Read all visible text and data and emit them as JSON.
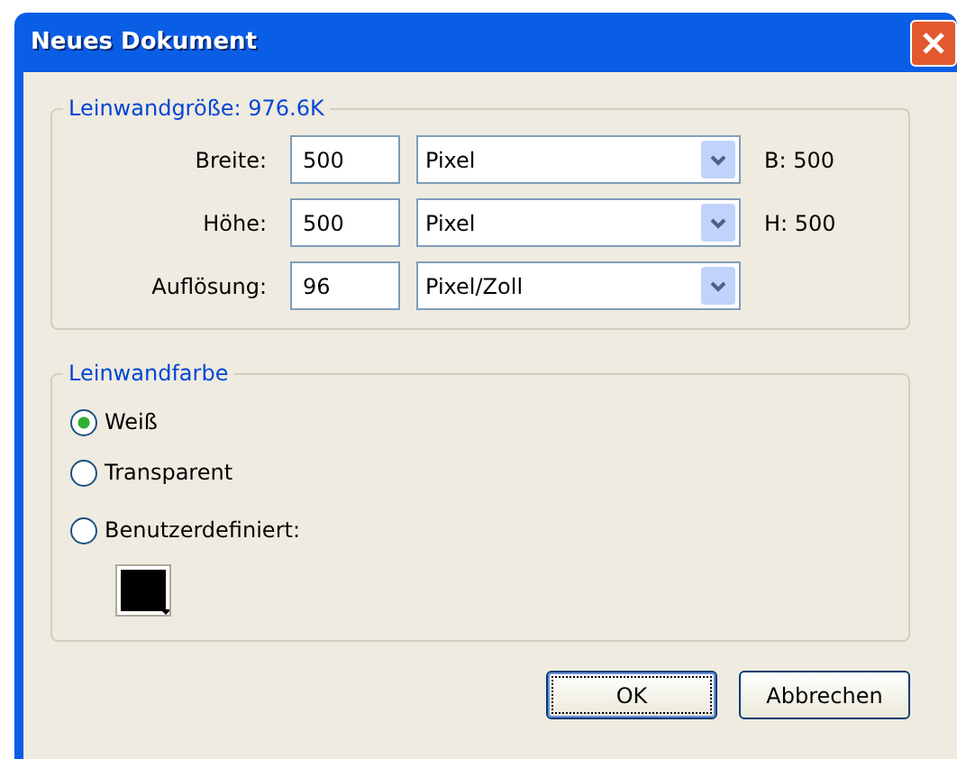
{
  "window": {
    "title": "Neues Dokument"
  },
  "canvas_size": {
    "legend": "Leinwandgröße: 976.6K",
    "rows": [
      {
        "label": "Breite:",
        "value": "500",
        "unit": "Pixel",
        "readout": "B: 500"
      },
      {
        "label": "Höhe:",
        "value": "500",
        "unit": "Pixel",
        "readout": "H: 500"
      },
      {
        "label": "Auflösung:",
        "value": "96",
        "unit": "Pixel/Zoll"
      }
    ]
  },
  "canvas_color": {
    "legend": "Leinwandfarbe",
    "options": [
      {
        "label": "Weiß",
        "selected": true
      },
      {
        "label": "Transparent",
        "selected": false
      },
      {
        "label": "Benutzerdefiniert:",
        "selected": false
      }
    ],
    "swatch": {
      "color": "#000000"
    }
  },
  "buttons": [
    {
      "label": "OK",
      "default": true
    },
    {
      "label": "Abbrechen",
      "default": false
    }
  ]
}
